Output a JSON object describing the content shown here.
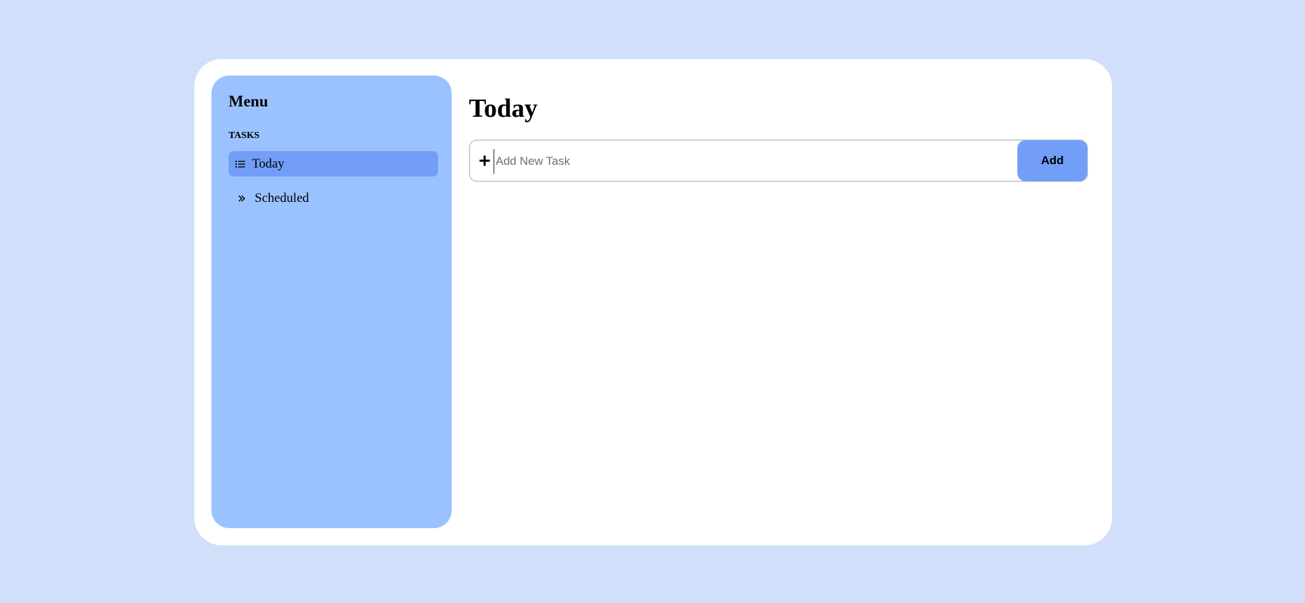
{
  "sidebar": {
    "title": "Menu",
    "section_label": "TASKS",
    "items": [
      {
        "label": "Today",
        "icon": "list-icon",
        "active": true
      },
      {
        "label": "Scheduled",
        "icon": "double-chevron-right-icon",
        "active": false
      }
    ]
  },
  "main": {
    "title": "Today",
    "new_task": {
      "placeholder": "Add New Task",
      "value": "",
      "icon": "plus-icon",
      "button_label": "Add"
    }
  },
  "colors": {
    "page_background": "#d1dffa",
    "card_background": "#ffffff",
    "sidebar_background": "#9ac2ff",
    "accent": "#729ef7"
  }
}
